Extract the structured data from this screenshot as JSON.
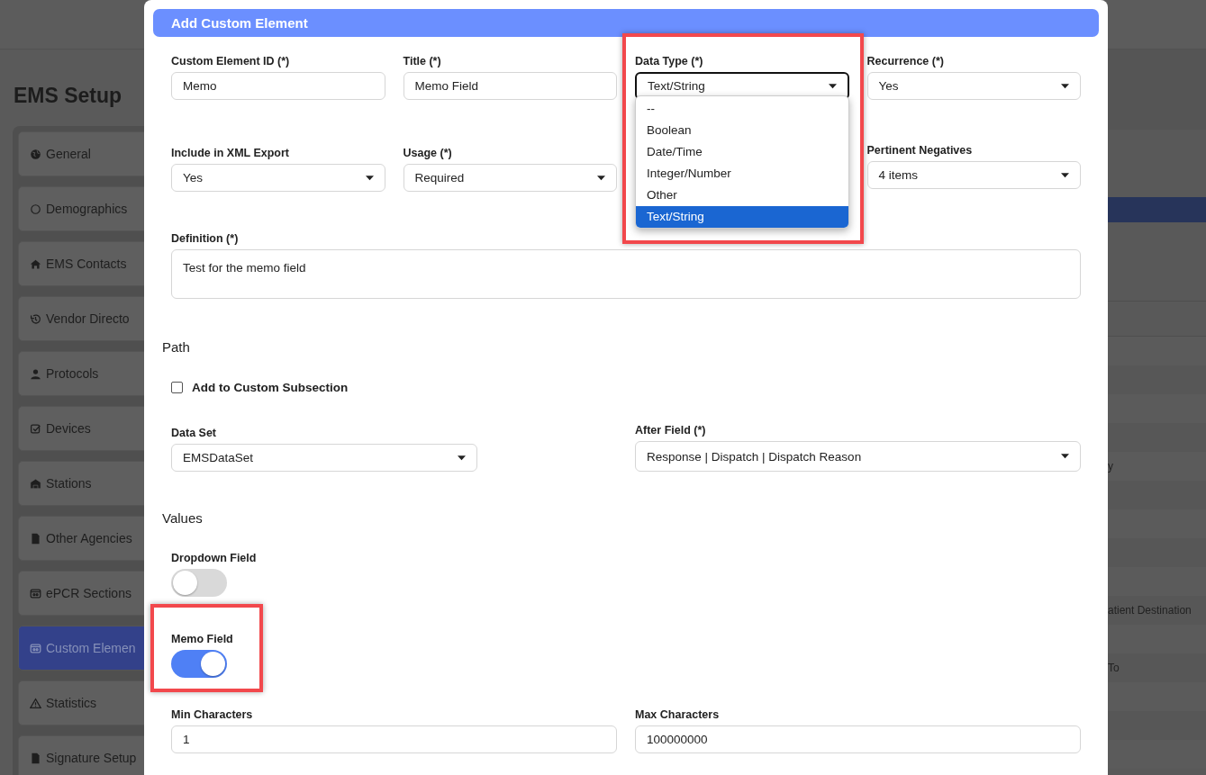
{
  "page": {
    "title": "EMS Setup",
    "sidebar": [
      {
        "label": "General",
        "selected": false
      },
      {
        "label": "Demographics",
        "selected": false
      },
      {
        "label": "EMS Contacts",
        "selected": false
      },
      {
        "label": "Vendor Directo",
        "selected": false
      },
      {
        "label": "Protocols",
        "selected": false
      },
      {
        "label": "Devices",
        "selected": false
      },
      {
        "label": "Stations",
        "selected": false
      },
      {
        "label": "Other Agencies",
        "selected": false
      },
      {
        "label": "ePCR Sections",
        "selected": false
      },
      {
        "label": "Custom Elemen",
        "selected": true
      },
      {
        "label": "Statistics",
        "selected": false
      },
      {
        "label": "Signature Setup",
        "selected": false
      }
    ],
    "table_cells": [
      "y",
      "atient Destination",
      "To"
    ]
  },
  "modal": {
    "title": "Add Custom Element",
    "rows": [
      [
        {
          "kind": "text",
          "label": "Custom Element ID (*)",
          "value": "Memo"
        },
        {
          "kind": "text",
          "label": "Title (*)",
          "value": "Memo Field"
        },
        {
          "kind": "select",
          "label": "Data Type (*)",
          "value": "Text/String",
          "focused": true,
          "highlighted": true,
          "open": true,
          "options": [
            {
              "label": "--",
              "selected": false
            },
            {
              "label": "Boolean",
              "selected": false
            },
            {
              "label": "Date/Time",
              "selected": false
            },
            {
              "label": "Integer/Number",
              "selected": false
            },
            {
              "label": "Other",
              "selected": false
            },
            {
              "label": "Text/String",
              "selected": true
            }
          ]
        },
        {
          "kind": "select",
          "label": "Recurrence (*)",
          "value": "Yes"
        }
      ],
      [
        {
          "kind": "select",
          "label": "Include in XML Export",
          "value": "Yes"
        },
        {
          "kind": "select",
          "label": "Usage (*)",
          "value": "Required"
        },
        "",
        {
          "kind": "select",
          "label": "Pertinent Negatives",
          "value": "4 items"
        }
      ]
    ],
    "definition": {
      "label": "Definition (*)",
      "value": "Test for the memo field"
    },
    "path": {
      "heading": "Path",
      "checkbox": {
        "label": "Add to Custom Subsection",
        "checked": false
      },
      "data_set": {
        "label": "Data Set",
        "value": "EMSDataSet"
      },
      "after_field": {
        "label": "After Field (*)",
        "value": "Response | Dispatch | Dispatch Reason"
      }
    },
    "values": {
      "heading": "Values",
      "toggles": [
        {
          "label": "Dropdown Field",
          "on": false,
          "highlighted": false
        },
        {
          "label": "Memo Field",
          "on": true,
          "highlighted": true
        }
      ],
      "min": {
        "label": "Min Characters",
        "value": "1"
      },
      "max": {
        "label": "Max Characters",
        "value": "100000000"
      }
    }
  }
}
